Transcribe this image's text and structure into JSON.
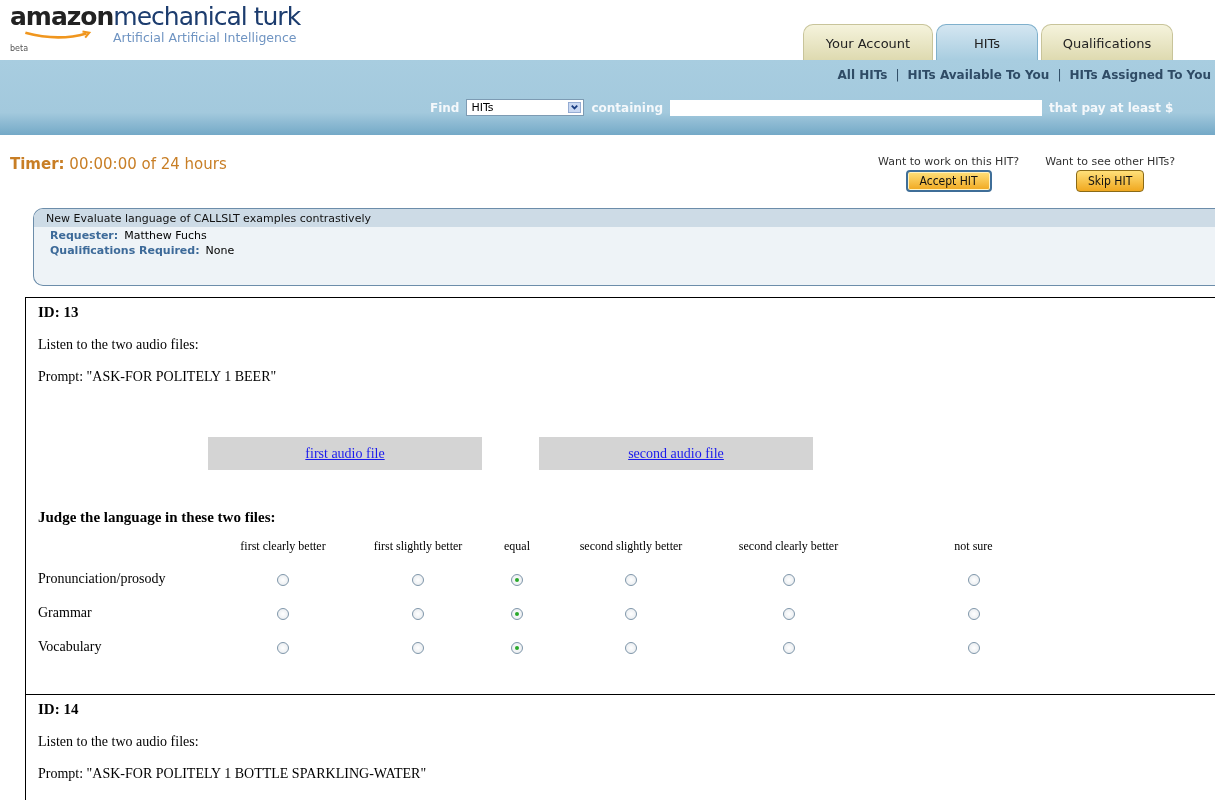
{
  "logo": {
    "brand": "amazon",
    "product": "mechanical turk",
    "tagline": "Artificial Artificial Intelligence",
    "badge": "beta"
  },
  "tabs": [
    {
      "label": "Your Account",
      "selected": false
    },
    {
      "label": "HITs",
      "selected": true
    },
    {
      "label": "Qualifications",
      "selected": false
    }
  ],
  "nav_links": [
    "All HITs",
    "HITs Available To You",
    "HITs Assigned To You"
  ],
  "nav_separator": "|",
  "search": {
    "find_label": "Find",
    "select_value": "HITs",
    "containing_label": "containing",
    "pay_label": "that pay at least $"
  },
  "timer": {
    "label": "Timer:",
    "value": "00:00:00 of 24 hours"
  },
  "actions": [
    {
      "prompt": "Want to work on this HIT?",
      "button": "Accept HIT",
      "focused": true
    },
    {
      "prompt": "Want to see other HITs?",
      "button": "Skip HIT",
      "focused": false
    }
  ],
  "hit": {
    "title": "New Evaluate language of CALLSLT examples contrastively",
    "fields": [
      {
        "label": "Requester:",
        "value": "Matthew Fuchs"
      },
      {
        "label": "Qualifications Required:",
        "value": "None"
      }
    ]
  },
  "items": [
    {
      "id": "ID: 13",
      "instruction": "Listen to the two audio files:",
      "prompt": "Prompt: \"ASK-FOR POLITELY 1 BEER\"",
      "audio_links": [
        "first audio file",
        "second audio file"
      ],
      "judge_title": "Judge the language in these two files:",
      "columns": [
        "first clearly better",
        "first slightly better",
        "equal",
        "second slightly better",
        "second clearly better",
        "not sure"
      ],
      "rows": [
        {
          "label": "Pronunciation/prosody",
          "options": [
            {
              "selected": false
            },
            {
              "selected": false
            },
            {
              "selected": true
            },
            {
              "selected": false
            },
            {
              "selected": false
            },
            {
              "selected": false
            }
          ]
        },
        {
          "label": "Grammar",
          "options": [
            {
              "selected": false
            },
            {
              "selected": false
            },
            {
              "selected": true
            },
            {
              "selected": false
            },
            {
              "selected": false
            },
            {
              "selected": false
            }
          ]
        },
        {
          "label": "Vocabulary",
          "options": [
            {
              "selected": false
            },
            {
              "selected": false
            },
            {
              "selected": true
            },
            {
              "selected": false
            },
            {
              "selected": false
            },
            {
              "selected": false
            }
          ]
        }
      ]
    },
    {
      "id": "ID: 14",
      "instruction": "Listen to the two audio files:",
      "prompt": "Prompt: \"ASK-FOR POLITELY 1 BOTTLE SPARKLING-WATER\""
    }
  ]
}
